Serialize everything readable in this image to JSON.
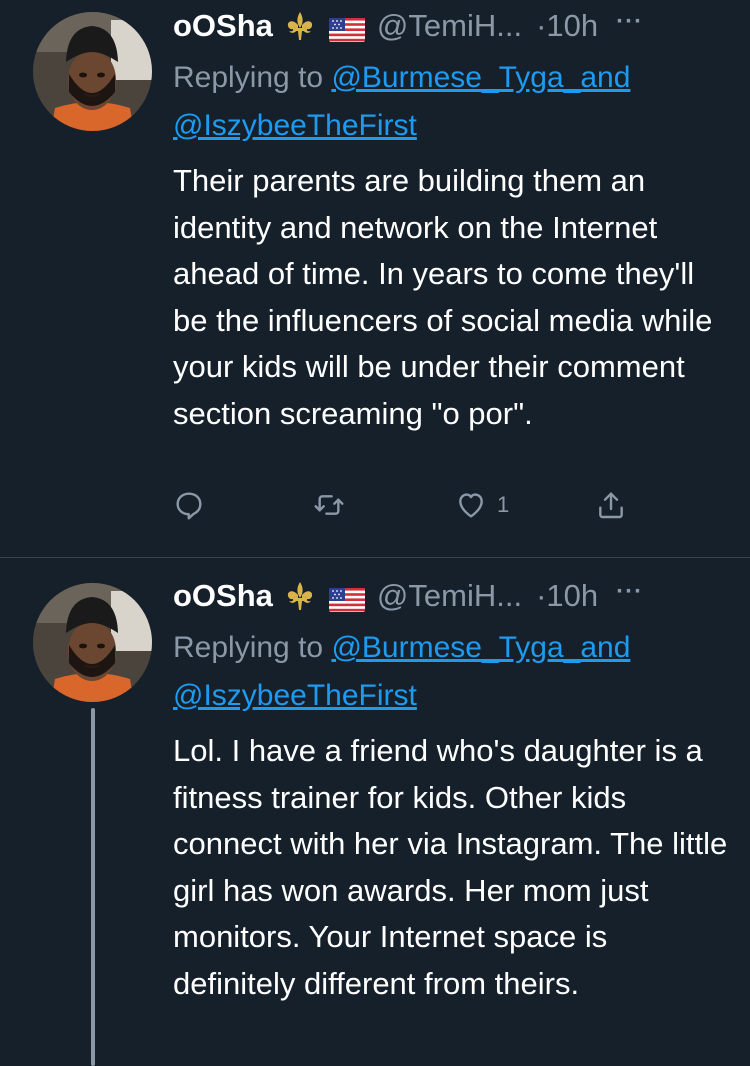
{
  "tweets": [
    {
      "author_name": "oOSha",
      "handle": "@TemiH...",
      "time": "·10h",
      "more": "···",
      "replying_prefix": "Replying to",
      "mention_1": "@Burmese_Tyga_",
      "mention_joiner": "and",
      "mention_2": "@IszybeeTheFirst",
      "body": "Their parents are building them an identity and network on the Internet ahead of time. In years to come they'll be the influencers of social media while your kids will be under their comment section screaming \"o por\".",
      "like_count": "1",
      "icons": [
        "reply-icon",
        "retweet-icon",
        "like-icon",
        "share-icon"
      ]
    },
    {
      "author_name": "oOSha",
      "handle": "@TemiH...",
      "time": "·10h",
      "more": "···",
      "replying_prefix": "Replying to",
      "mention_1": "@Burmese_Tyga_",
      "mention_joiner": "and",
      "mention_2": "@IszybeeTheFirst",
      "body": "Lol. I have a friend who's daughter is a fitness trainer for kids. Other kids connect with her via Instagram. The little girl has won awards. Her mom just monitors. Your Internet space is definitely different from theirs."
    }
  ],
  "colors": {
    "background": "#15202b",
    "text_primary": "#ffffff",
    "text_secondary": "#8b98a5",
    "link": "#1d9bf0",
    "divider": "#38444d",
    "fleur_de_lis": "#d9b44a"
  }
}
